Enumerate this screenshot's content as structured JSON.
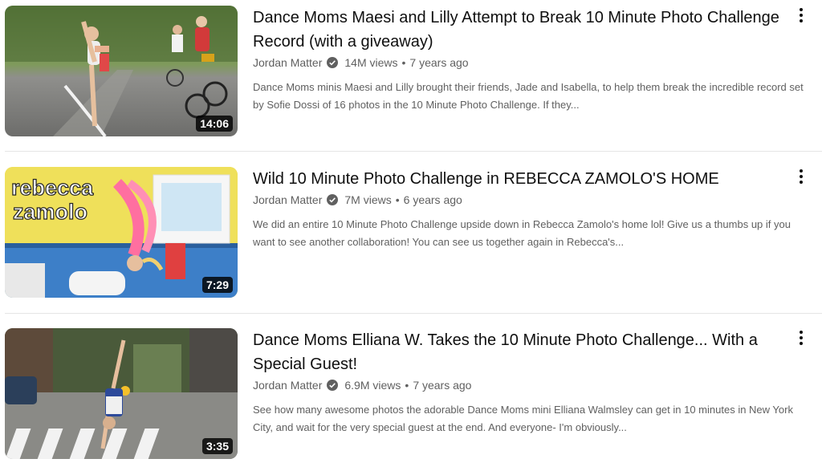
{
  "videos": [
    {
      "title": "Dance Moms Maesi and Lilly Attempt to Break 10 Minute Photo Challenge Record (with a giveaway)",
      "channel": "Jordan Matter",
      "views": "14M views",
      "age": "7 years ago",
      "description": "Dance Moms minis Maesi and Lilly brought their friends, Jade and Isabella, to help them break the incredible record set by Sofie Dossi of 16 photos in the 10 Minute Photo Challenge. If they...",
      "duration": "14:06"
    },
    {
      "title": "Wild 10 Minute Photo Challenge in REBECCA ZAMOLO'S HOME",
      "channel": "Jordan Matter",
      "views": "7M views",
      "age": "6 years ago",
      "description": "We did an entire 10 Minute Photo Challenge upside down in Rebecca Zamolo's home lol! Give us a thumbs up if you want to see another collaboration! You can see us together again in Rebecca's...",
      "duration": "7:29",
      "thumb_text_1": "rebecca",
      "thumb_text_2": "zamolo"
    },
    {
      "title": "Dance Moms Elliana W. Takes the 10 Minute Photo Challenge... With a Special Guest!",
      "channel": "Jordan Matter",
      "views": "6.9M views",
      "age": "7 years ago",
      "description": "See how many awesome photos the adorable Dance Moms mini Elliana Walmsley can get in 10 minutes in New York City, and wait for the very special guest at the end. And everyone- I'm obviously...",
      "duration": "3:35"
    }
  ],
  "icons": {
    "verified": "verified-check-icon",
    "more": "more-vert-icon"
  },
  "separator": "•"
}
